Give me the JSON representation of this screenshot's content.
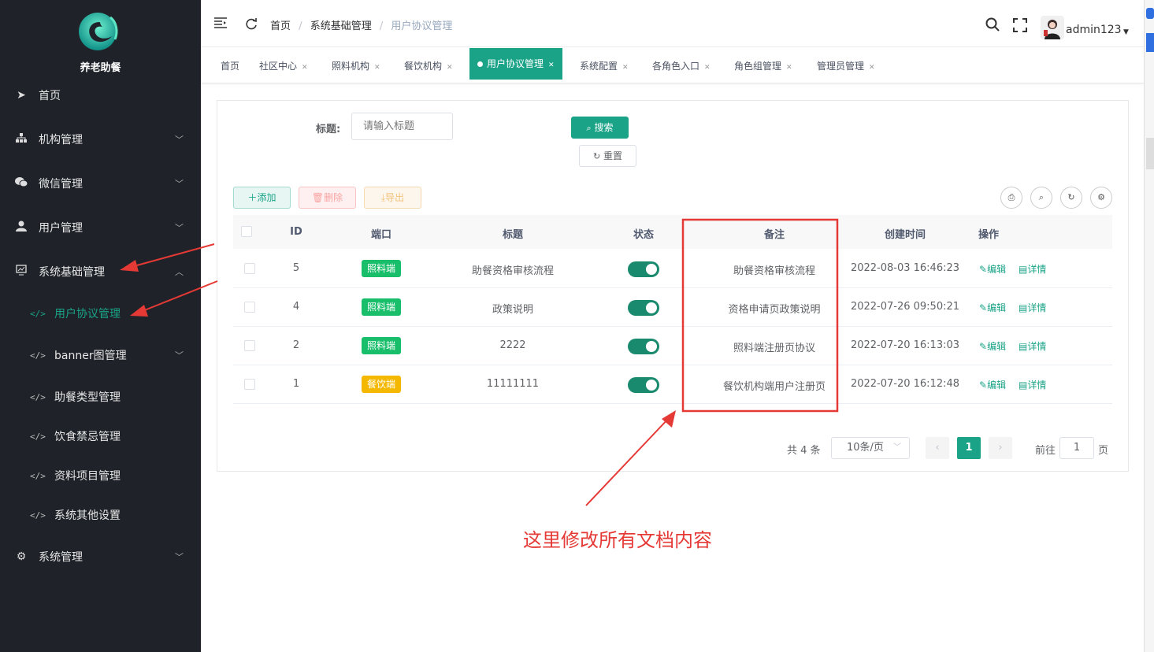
{
  "sidebar": {
    "logo_text": "养老助餐",
    "items": [
      {
        "label": "首页",
        "icon": "paper-plane-icon"
      },
      {
        "label": "机构管理",
        "icon": "sitemap-icon"
      },
      {
        "label": "微信管理",
        "icon": "wechat-icon"
      },
      {
        "label": "用户管理",
        "icon": "user-icon"
      },
      {
        "label": "系统基础管理",
        "icon": "dashboard-icon"
      },
      {
        "label": "系统管理",
        "icon": "gear-icon"
      }
    ],
    "sub_items": [
      {
        "label": "用户协议管理"
      },
      {
        "label": "banner图管理"
      },
      {
        "label": "助餐类型管理"
      },
      {
        "label": "饮食禁忌管理"
      },
      {
        "label": "资料项目管理"
      },
      {
        "label": "系统其他设置"
      }
    ]
  },
  "header": {
    "breadcrumb": [
      "首页",
      "系统基础管理",
      "用户协议管理"
    ],
    "username": "admin123"
  },
  "tabs": [
    "首页",
    "社区中心",
    "照料机构",
    "餐饮机构",
    "用户协议管理",
    "系统配置",
    "各角色入口",
    "角色组管理",
    "管理员管理"
  ],
  "search": {
    "label": "标题:",
    "placeholder": "请输入标题",
    "search_button": "搜索",
    "reset_button": "重置"
  },
  "toolbar": {
    "add": "添加",
    "delete": "删除",
    "export": "导出"
  },
  "table": {
    "columns": [
      "ID",
      "端口",
      "标题",
      "状态",
      "备注",
      "创建时间",
      "操作"
    ],
    "rows": [
      {
        "id": "5",
        "port": "照料端",
        "title": "助餐资格审核流程",
        "status": true,
        "remark": "助餐资格审核流程",
        "created": "2022-08-03 16:46:23"
      },
      {
        "id": "4",
        "port": "照料端",
        "title": "政策说明",
        "status": true,
        "remark": "资格申请页政策说明",
        "created": "2022-07-26 09:50:21"
      },
      {
        "id": "2",
        "port": "照料端",
        "title": "2222",
        "status": true,
        "remark": "照料端注册页协议",
        "created": "2022-07-20 16:13:03"
      },
      {
        "id": "1",
        "port": "餐饮端",
        "title": "11111111",
        "status": true,
        "remark": "餐饮机构端用户注册页",
        "created": "2022-07-20 16:12:48"
      }
    ],
    "edit_label": "编辑",
    "detail_label": "详情"
  },
  "pagination": {
    "total": "共 4 条",
    "page_size": "10条/页",
    "current_page": "1",
    "goto_prefix": "前往",
    "goto_value": "1",
    "goto_suffix": "页"
  },
  "annotation": {
    "text": "这里修改所有文档内容"
  },
  "colors": {
    "sidebar_bg": "#1f2329",
    "accent": "#1aa387",
    "badge_green": "#19be6b",
    "badge_orange": "#f5b800",
    "annotation_red": "#e53935"
  }
}
